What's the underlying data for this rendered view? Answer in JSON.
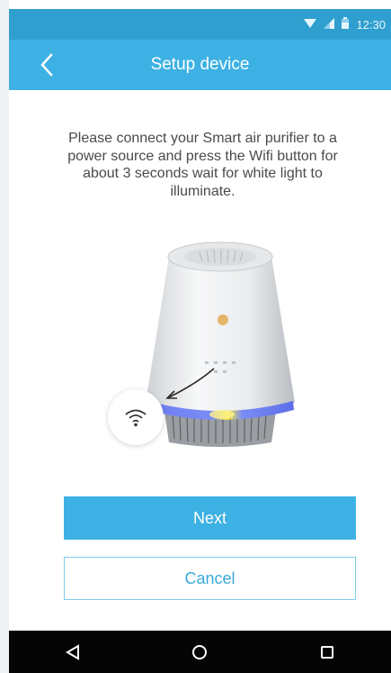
{
  "status_bar": {
    "time": "12:30",
    "icons": [
      "wifi-icon",
      "signal-icon",
      "battery-icon"
    ]
  },
  "app_bar": {
    "title": "Setup device",
    "back_icon": "chevron-left-icon"
  },
  "instructions": "Please connect your Smart air purifier to a power source and press the Wifi button for about 3 seconds wait for white light to illuminate.",
  "illustration": {
    "device": "air-purifier",
    "badge_icon": "wifi-icon",
    "colors": {
      "accent": "#3db1e3",
      "ring_blue": "#5a7cf2",
      "ring_yellow": "#f4de2c"
    }
  },
  "buttons": {
    "next_label": "Next",
    "cancel_label": "Cancel"
  },
  "nav_bar": {
    "icons": [
      "back-triangle-icon",
      "home-circle-icon",
      "recents-square-icon"
    ]
  },
  "colors": {
    "status_bar": "#2e9fcf",
    "app_bar": "#3db1e3",
    "text": "#4a4a4a"
  }
}
